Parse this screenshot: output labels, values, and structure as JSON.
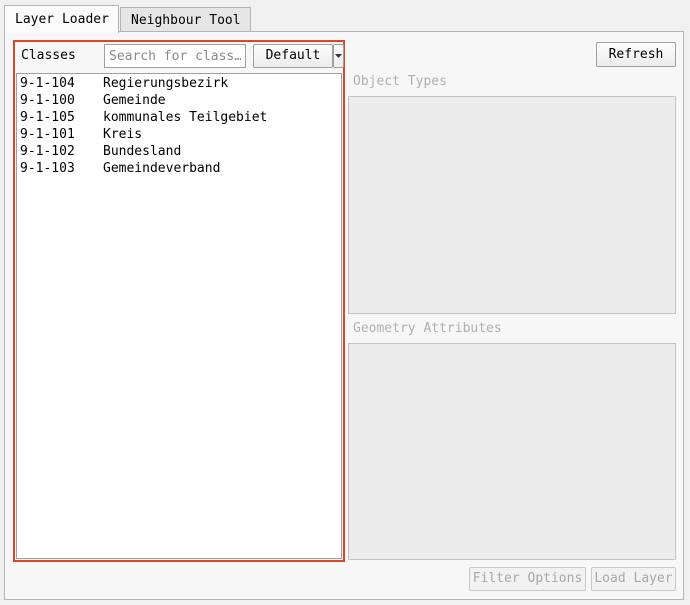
{
  "tabs": [
    {
      "label": "Layer Loader",
      "active": true
    },
    {
      "label": "Neighbour Tool",
      "active": false
    }
  ],
  "classes_panel": {
    "label": "Classes",
    "search_placeholder": "Search for class…",
    "search_value": "",
    "profile_selected": "Default",
    "dropdown_icon": "triangle-down",
    "items": [
      {
        "code": "9-1-104",
        "name": "Regierungsbezirk"
      },
      {
        "code": "9-1-100",
        "name": "Gemeinde"
      },
      {
        "code": "9-1-105",
        "name": "kommunales Teilgebiet"
      },
      {
        "code": "9-1-101",
        "name": "Kreis"
      },
      {
        "code": "9-1-102",
        "name": "Bundesland"
      },
      {
        "code": "9-1-103",
        "name": "Gemeindeverband"
      }
    ]
  },
  "right_panel": {
    "refresh_label": "Refresh",
    "object_types_label": "Object Types",
    "geometry_attributes_label": "Geometry Attributes",
    "filter_options_label": "Filter Options",
    "load_layer_label": "Load Layer"
  },
  "colors": {
    "highlight_border": "#d9472f",
    "disabled_text": "#a8a8a8"
  }
}
